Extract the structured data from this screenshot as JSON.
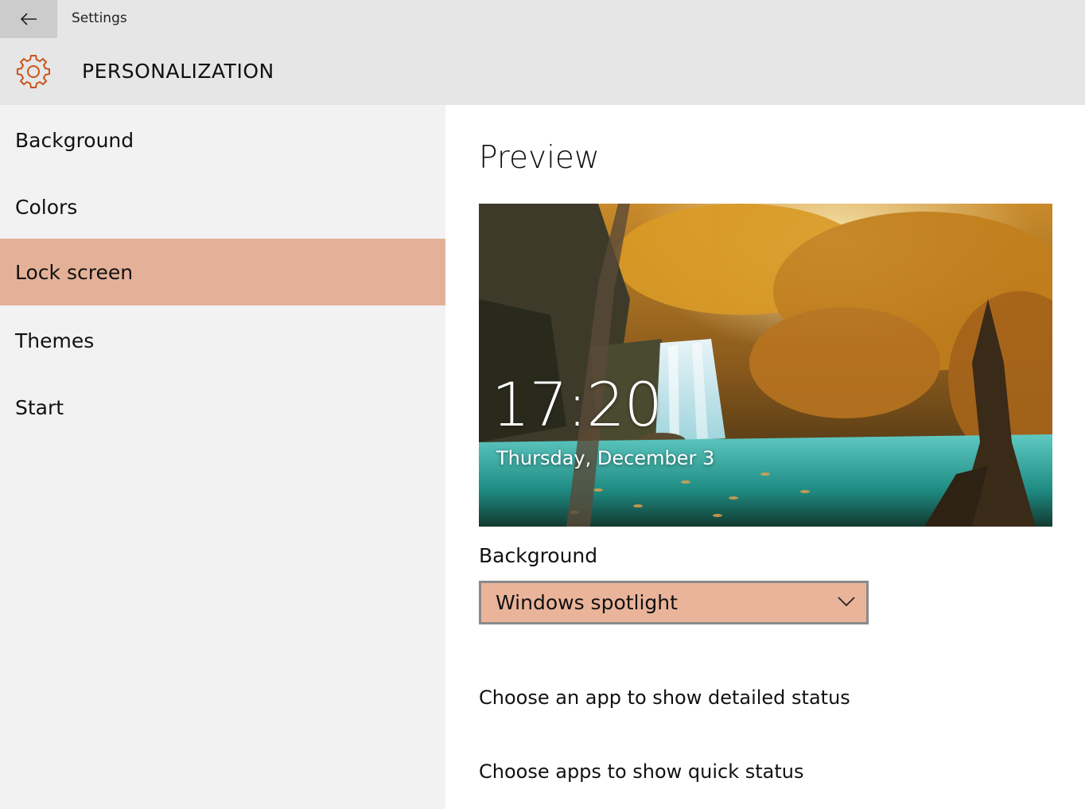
{
  "window": {
    "title": "Settings"
  },
  "header": {
    "title": "PERSONALIZATION",
    "icon": "gear-icon",
    "accent": "#c8551e"
  },
  "sidebar": {
    "items": [
      {
        "label": "Background"
      },
      {
        "label": "Colors"
      },
      {
        "label": "Lock screen",
        "selected": true
      },
      {
        "label": "Themes"
      },
      {
        "label": "Start"
      }
    ],
    "selected_color": "#e4b198"
  },
  "main": {
    "preview_title": "Preview",
    "lock_preview": {
      "time": "17:20",
      "date": "Thursday, December 3"
    },
    "background_label": "Background",
    "background_dropdown": {
      "value": "Windows spotlight",
      "icon": "chevron-down-icon"
    },
    "links": [
      "Choose an app to show detailed status",
      "Choose apps to show quick status"
    ]
  }
}
